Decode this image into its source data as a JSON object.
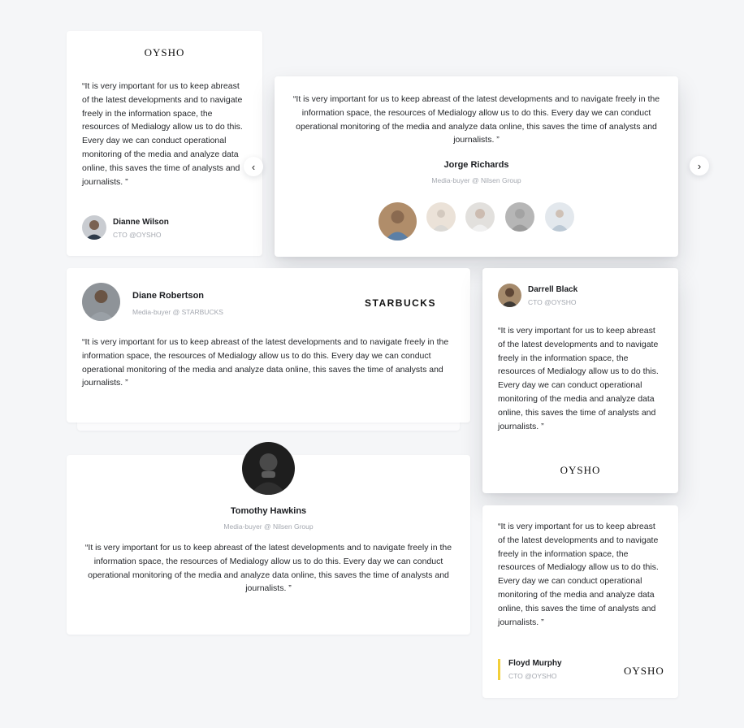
{
  "quote": "“It is very important for us to keep abreast of the latest developments and to navigate freely in the information space, the resources of Medialogy allow us to do this. Every day we can conduct operational monitoring of the media and analyze data online, this saves the time of analysts and journalists. ”",
  "brand_oysho": "OYSHO",
  "brand_starbucks": "STARBUCKS",
  "nav": {
    "prev": "‹",
    "next": "›"
  },
  "cards": {
    "dianne": {
      "name": "Dianne Wilson",
      "role": "CTO @OYSHO"
    },
    "jorge": {
      "name": "Jorge Richards",
      "role": "Media-buyer @ Nilsen Group"
    },
    "diane": {
      "name": "Diane Robertson",
      "role": "Media-buyer @ STARBUCKS"
    },
    "darrell": {
      "name": "Darrell Black",
      "role": "CTO @OYSHO"
    },
    "tomothy": {
      "name": "Tomothy Hawkins",
      "role": "Media-buyer @ Nilsen Group"
    },
    "floyd": {
      "name": "Floyd Murphy",
      "role": "CTO @OYSHO"
    }
  },
  "colors": {
    "accent_bar": "#f2cf3a",
    "background": "#f5f6f8"
  }
}
